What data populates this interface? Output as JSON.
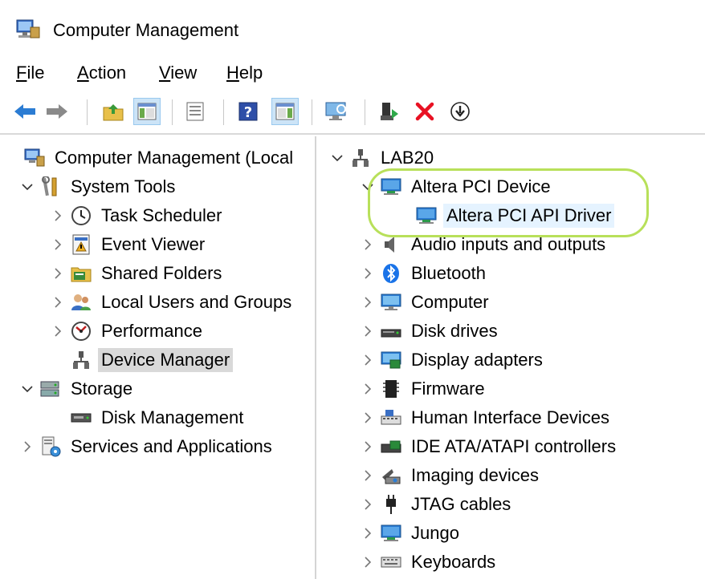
{
  "window": {
    "title": "Computer Management"
  },
  "menu": [
    {
      "label": "File",
      "accel": "F",
      "rest": "ile"
    },
    {
      "label": "Action",
      "accel": "A",
      "rest": "ction"
    },
    {
      "label": "View",
      "accel": "V",
      "rest": "iew"
    },
    {
      "label": "Help",
      "accel": "H",
      "rest": "elp"
    }
  ],
  "toolbar": {
    "buttons": [
      "back-icon",
      "forward-icon",
      "up-folder-icon",
      "show-hide-console-tree-icon",
      "properties-icon",
      "help-icon",
      "show-hide-action-pane-icon",
      "monitor-icon",
      "update-driver-icon",
      "uninstall-icon",
      "install-icon"
    ]
  },
  "left_tree": [
    {
      "label": "Computer Management (Local",
      "icon": "computer-management-icon",
      "expander": "",
      "indent": 0
    },
    {
      "label": "System Tools",
      "icon": "tools-icon",
      "expander": "v",
      "indent": 0
    },
    {
      "label": "Task Scheduler",
      "icon": "clock-icon",
      "expander": ">",
      "indent": 1
    },
    {
      "label": "Event Viewer",
      "icon": "event-viewer-icon",
      "expander": ">",
      "indent": 1
    },
    {
      "label": "Shared Folders",
      "icon": "shared-folder-icon",
      "expander": ">",
      "indent": 1
    },
    {
      "label": "Local Users and Groups",
      "icon": "users-icon",
      "expander": ">",
      "indent": 1
    },
    {
      "label": "Performance",
      "icon": "performance-icon",
      "expander": ">",
      "indent": 1
    },
    {
      "label": "Device Manager",
      "icon": "device-manager-icon",
      "expander": "",
      "indent": 1,
      "selected": true
    },
    {
      "label": "Storage",
      "icon": "storage-icon",
      "expander": "v",
      "indent": 0
    },
    {
      "label": "Disk Management",
      "icon": "disk-management-icon",
      "expander": "",
      "indent": 1
    },
    {
      "label": "Services and Applications",
      "icon": "services-icon",
      "expander": ">",
      "indent": 0
    }
  ],
  "device_tree": [
    {
      "label": "LAB20",
      "icon": "computer-network-icon",
      "expander": "v",
      "indent": 0
    },
    {
      "label": "Altera PCI Device",
      "icon": "monitor-device-icon",
      "expander": "v",
      "indent": 1
    },
    {
      "label": "Altera PCI API Driver",
      "icon": "monitor-device-icon",
      "expander": "",
      "indent": 2,
      "selected": true
    },
    {
      "label": "Audio inputs and outputs",
      "icon": "speaker-icon",
      "expander": ">",
      "indent": 1
    },
    {
      "label": "Bluetooth",
      "icon": "bluetooth-icon",
      "expander": ">",
      "indent": 1
    },
    {
      "label": "Computer",
      "icon": "monitor-icon",
      "expander": ">",
      "indent": 1
    },
    {
      "label": "Disk drives",
      "icon": "disk-drive-icon",
      "expander": ">",
      "indent": 1
    },
    {
      "label": "Display adapters",
      "icon": "display-adapter-icon",
      "expander": ">",
      "indent": 1
    },
    {
      "label": "Firmware",
      "icon": "firmware-icon",
      "expander": ">",
      "indent": 1
    },
    {
      "label": "Human Interface Devices",
      "icon": "hid-icon",
      "expander": ">",
      "indent": 1
    },
    {
      "label": "IDE ATA/ATAPI controllers",
      "icon": "ide-controller-icon",
      "expander": ">",
      "indent": 1
    },
    {
      "label": "Imaging devices",
      "icon": "camera-icon",
      "expander": ">",
      "indent": 1
    },
    {
      "label": "JTAG cables",
      "icon": "jtag-icon",
      "expander": ">",
      "indent": 1
    },
    {
      "label": "Jungo",
      "icon": "monitor-device-icon",
      "expander": ">",
      "indent": 1
    },
    {
      "label": "Keyboards",
      "icon": "keyboard-icon",
      "expander": ">",
      "indent": 1
    }
  ],
  "colors": {
    "highlight_oval": "#b8e05a",
    "selection": "#d9d9d9",
    "uninstall_red": "#e81123",
    "back_blue": "#2b7cd3"
  }
}
